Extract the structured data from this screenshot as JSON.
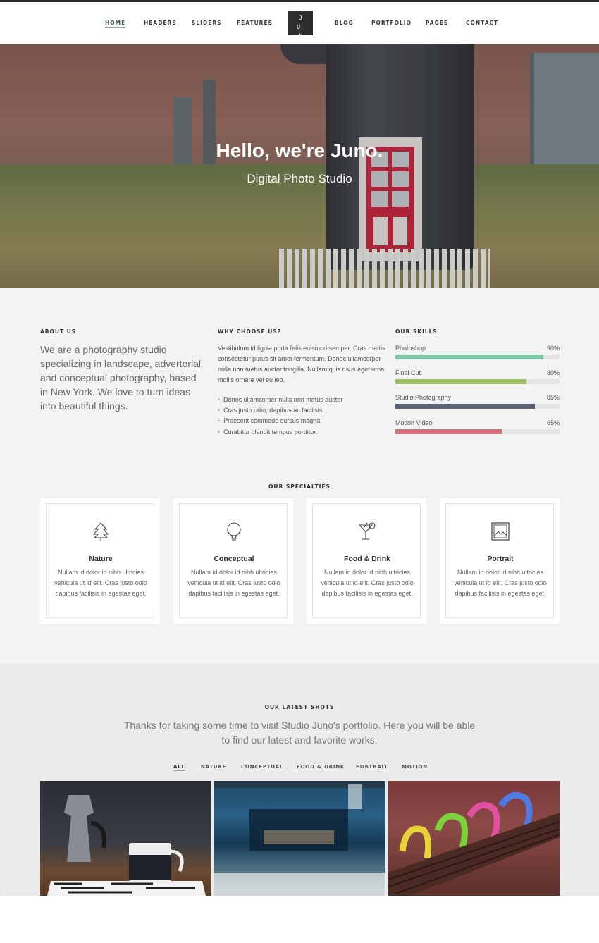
{
  "nav": {
    "items": [
      "HOME",
      "HEADERS",
      "SLIDERS",
      "FEATURES",
      "BLOG",
      "PORTFOLIO",
      "PAGES",
      "CONTACT"
    ],
    "logo_top": "J U",
    "logo_bottom": "N O"
  },
  "hero": {
    "title": "Hello, we're Juno.",
    "subtitle": "Digital Photo Studio"
  },
  "about": {
    "heading": "ABOUT US",
    "text": "We are a photography studio specializing in landscape, advertorial and conceptual photography, based in New York. We love to turn ideas into beautiful things."
  },
  "why": {
    "heading": "WHY CHOOSE US?",
    "text": "Vestibulum id ligula porta felis euismod semper. Cras mattis consectetur purus sit amet fermentum. Donec ullamcorper nulla non metus auctor fringilla. Nullam quis risus eget urna mollis ornare vel eu leo.",
    "list": [
      "Donec ullamcorper nulla non metus auctor",
      "Cras justo odio, dapibus ac facilisis.",
      "Praesent commodo cursus magna.",
      "Curabitur blandit tempus porttitor."
    ]
  },
  "skills": {
    "heading": "OUR SKILLS",
    "items": [
      {
        "label": "Photoshop",
        "pct": "90%",
        "value": 0.9,
        "color": "#7cc6a3"
      },
      {
        "label": "Final Cut",
        "pct": "80%",
        "value": 0.8,
        "color": "#9cbf62"
      },
      {
        "label": "Studio Photography",
        "pct": "85%",
        "value": 0.85,
        "color": "#5b6475"
      },
      {
        "label": "Motion Video",
        "pct": "65%",
        "value": 0.65,
        "color": "#d8707f"
      }
    ]
  },
  "specialties": {
    "heading": "OUR SPECIALTIES",
    "items": [
      {
        "title": "Nature",
        "icon": "tree-icon",
        "desc": "Nullam id dolor id nibh ultricies vehicula ut id elit. Cras justo odio dapibus facilisis in egestas eget."
      },
      {
        "title": "Conceptual",
        "icon": "lightbulb-icon",
        "desc": "Nullam id dolor id nibh ultricies vehicula ut id elit. Cras justo odio dapibus facilisis in egestas eget."
      },
      {
        "title": "Food & Drink",
        "icon": "cocktail-icon",
        "desc": "Nullam id dolor id nibh ultricies vehicula ut id elit. Cras justo odio dapibus facilisis in egestas eget."
      },
      {
        "title": "Portrait",
        "icon": "picture-icon",
        "desc": "Nullam id dolor id nibh ultricies vehicula ut id elit. Cras justo odio dapibus facilisis in egestas eget."
      }
    ]
  },
  "shots": {
    "heading": "OUR LATEST SHOTS",
    "intro": "Thanks for taking some time to visit Studio Juno's portfolio. Here you will be able to find our latest and favorite works.",
    "filters": [
      "ALL",
      "NATURE",
      "CONCEPTUAL",
      "FOOD & DRINK",
      "PORTRAIT",
      "MOTION"
    ]
  },
  "colors": {
    "accent_green": "#7cb593",
    "dark": "#2d2d2d"
  }
}
